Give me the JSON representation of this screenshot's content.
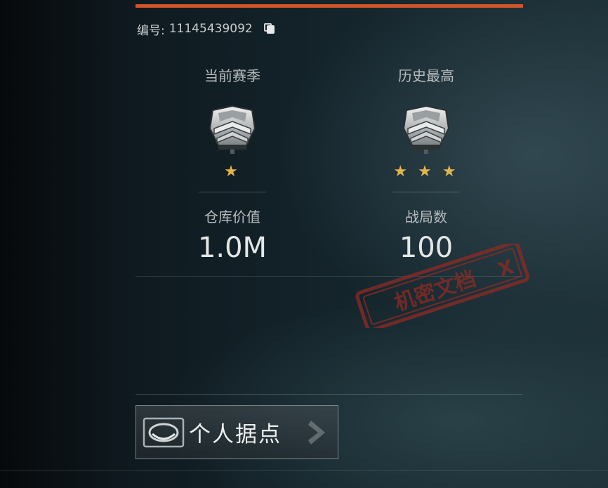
{
  "profile": {
    "id_label": "编号:",
    "id_value": "11145439092"
  },
  "ranks": {
    "current_season": {
      "title": "当前赛季",
      "stars": "★"
    },
    "history_best": {
      "title": "历史最高",
      "stars": "★ ★ ★"
    }
  },
  "stats": {
    "warehouse": {
      "label": "仓库价值",
      "value": "1.0M"
    },
    "matches": {
      "label": "战局数",
      "value": "100"
    }
  },
  "stamp_text": "机密文档",
  "actions": {
    "personal_base_label": "个人据点"
  },
  "colors": {
    "accent": "#d2552a",
    "star": "#e3b44c",
    "stamp": "#8f2a24"
  },
  "icons": [
    "copy-icon",
    "rank-badge-icon",
    "star-icon",
    "base-icon",
    "chevron-right-icon"
  ]
}
